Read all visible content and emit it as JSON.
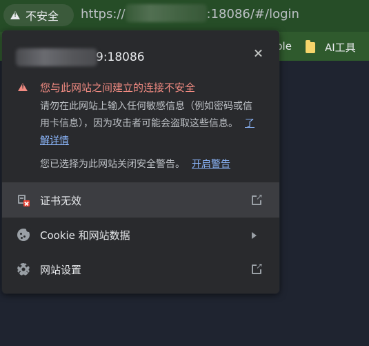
{
  "omnibox": {
    "security_label": "不安全",
    "url_scheme": "https://",
    "url_rest": ":18086/#/login"
  },
  "bookmarks": {
    "partial_item": "ple",
    "ai_tools": "AI工具"
  },
  "popup": {
    "host_port": "9:18086",
    "warning_title": "您与此网站之间建立的连接不安全",
    "warning_body": "请勿在此网站上输入任何敏感信息（例如密码或信用卡信息），因为攻击者可能会盗取这些信息。",
    "learn_more": "了解详情",
    "disabled_note": "您已选择为此网站关闭安全警告。",
    "enable_link": "开启警告",
    "rows": [
      {
        "label": "证书无效",
        "icon": "certificate-invalid-icon",
        "trail": "external-link-icon"
      },
      {
        "label": "Cookie 和网站数据",
        "icon": "cookie-icon",
        "trail": "arrow-right-icon"
      },
      {
        "label": "网站设置",
        "icon": "gear-icon",
        "trail": "external-link-icon"
      }
    ]
  },
  "colors": {
    "warning_red": "#f28b82",
    "link_blue": "#8ab4f8",
    "popup_bg": "#292a2d",
    "toolbar_green": "#264d27"
  }
}
